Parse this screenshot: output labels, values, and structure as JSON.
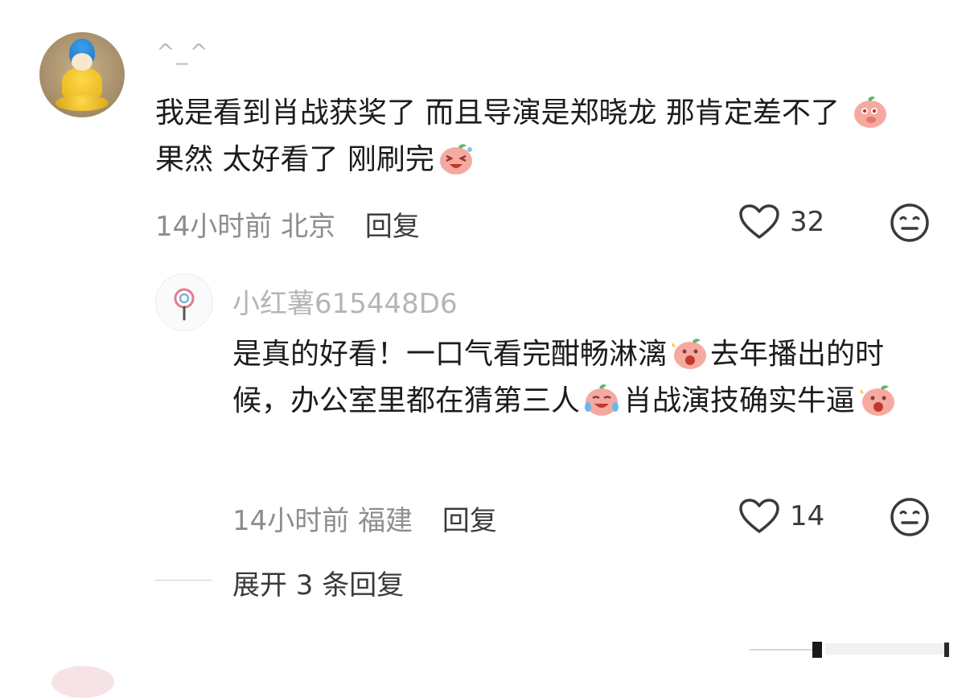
{
  "comment": {
    "username": "^_^",
    "text_segments": [
      "我是看到肖战获奖了 而且导演是郑晓龙 那肯定差不了 ",
      " 果然 太好看了 刚刷完"
    ],
    "time": "14小时前",
    "location": "北京",
    "reply_label": "回复",
    "likes": "32"
  },
  "reply": {
    "username": "小红薯615448D6",
    "text_segments": [
      "是真的好看！一口气看完酣畅淋漓",
      "去年播出的时候，办公室里都在猜第三人",
      "肖战演技确实牛逼"
    ],
    "time": "14小时前",
    "location": "福建",
    "reply_label": "回复",
    "likes": "14"
  },
  "expand_label": "展开 3 条回复",
  "icons": {
    "like": "heart-outline-icon",
    "dislike": "meh-face-icon"
  },
  "colors": {
    "text": "#1c1c1c",
    "meta": "#8d8d8d",
    "username": "#b9b9b9",
    "emoji_pink": "#f29a94"
  }
}
